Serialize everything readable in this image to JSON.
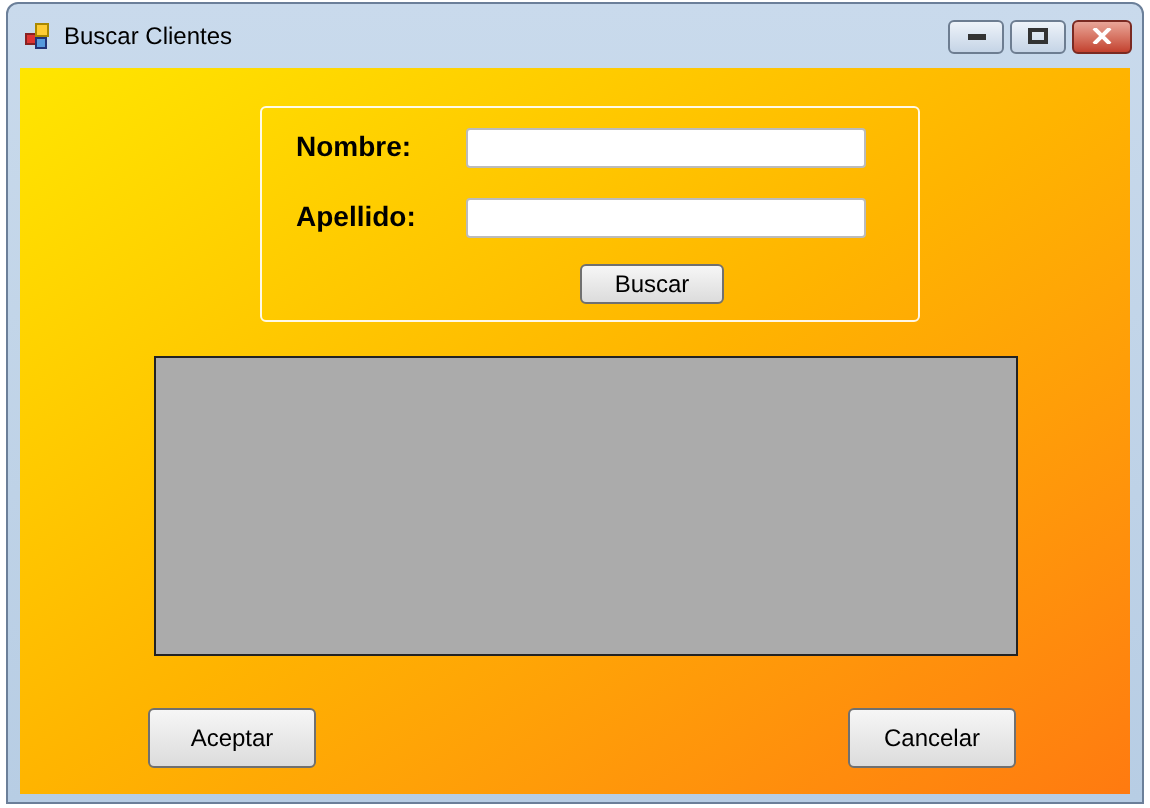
{
  "window": {
    "title": "Buscar Clientes"
  },
  "search_group": {
    "fields": [
      {
        "label": "Nombre:"
      },
      {
        "label": "Apellido:"
      }
    ],
    "button": "Buscar"
  },
  "buttons": [
    "Aceptar",
    "Cancelar"
  ]
}
